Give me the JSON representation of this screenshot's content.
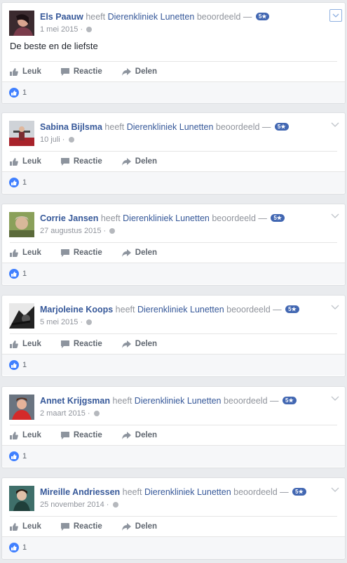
{
  "common": {
    "verb": "heeft",
    "page_name": "Dierenkliniek Lunetten",
    "rated": "beoordeeld —",
    "badge": "5★",
    "actions": {
      "like": "Leuk",
      "comment": "Reactie",
      "share": "Delen"
    },
    "colors": {
      "link": "#365899",
      "accent": "#4267b2",
      "reaction": "#4080ff"
    }
  },
  "reviews": [
    {
      "name": "Els Paauw",
      "date": "1 mei 2015",
      "text": "De beste en de liefste",
      "likes": "1"
    },
    {
      "name": "Sabina Bijlsma",
      "date": "10 juli",
      "likes": "1"
    },
    {
      "name": "Corrie Jansen",
      "date": "27 augustus 2015",
      "likes": "1"
    },
    {
      "name": "Marjoleine Koops",
      "date": "5 mei 2015",
      "likes": "1"
    },
    {
      "name": "Annet Krijgsman",
      "date": "2 maart 2015",
      "likes": "1"
    },
    {
      "name": "Mireille Andriessen",
      "date": "25 november 2014",
      "likes": "1"
    }
  ]
}
